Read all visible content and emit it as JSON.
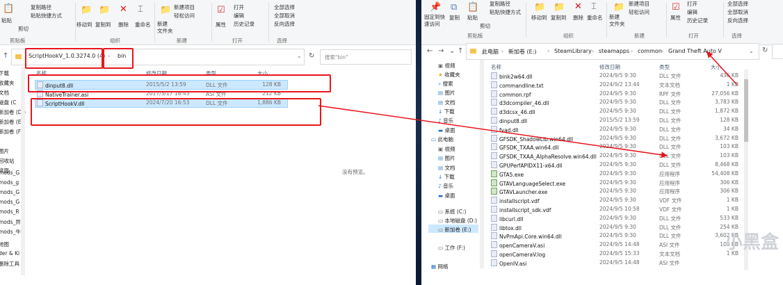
{
  "left": {
    "ribbon": {
      "paste": "粘贴",
      "copy_path": "复制路径",
      "paste_shortcut": "粘贴快捷方式",
      "cut": "剪切",
      "move_to": "移动到",
      "copy_to": "复制到",
      "delete": "删除",
      "rename": "重命名",
      "new_folder": "新建\n文件夹",
      "new_item": "新建项目",
      "easy_access": "轻松访问",
      "properties": "属性",
      "open": "打开",
      "edit": "编辑",
      "history": "历史记录",
      "select_all": "全部选择",
      "select_none": "全部取消",
      "invert": "反向选择",
      "groups": [
        "剪贴板",
        "组织",
        "新建",
        "打开",
        "选择"
      ]
    },
    "breadcrumb": [
      "ScriptHookV_1.0.3274.0 (4)",
      "bin"
    ],
    "search_placeholder": "搜索\"bin\"",
    "sidebar": [
      "下载",
      "收藏夹",
      "文档",
      "磁盘 (C",
      "新加卷 (D:)",
      "新加卷 (E:)",
      "新加卷 (F:)",
      "图片",
      "回收站",
      "桌面",
      "mods_G",
      "mods_g",
      "mods_G",
      "mods_G",
      "mods_R",
      "mods_异",
      "mods_牛",
      "地图",
      "der & Ki",
      "删除工具"
    ],
    "columns": {
      "name": "名称",
      "date": "修改日期",
      "type": "类型",
      "size": "大小"
    },
    "files": [
      {
        "name": "dinput8.dll",
        "date": "2015/5/2 13:59",
        "type": "DLL 文件",
        "size": "128 KB"
      },
      {
        "name": "NativeTrainer.asi",
        "date": "2017/3/17 18:43",
        "type": "ASI 文件",
        "size": "212 KB"
      },
      {
        "name": "ScriptHookV.dll",
        "date": "2024/7/20 16:53",
        "type": "DLL 文件",
        "size": "1,886 KB"
      }
    ],
    "preview_empty": "没有预览。"
  },
  "right": {
    "ribbon": {
      "pin": "固定到快\n速访问",
      "copy": "复制",
      "paste": "粘贴",
      "copy_path": "复制路径",
      "paste_shortcut": "粘贴快捷方式",
      "cut": "剪切",
      "move_to": "移动到",
      "copy_to": "复制到",
      "delete": "删除",
      "rename": "重命名",
      "new_folder": "新建\n文件夹",
      "new_item": "新建项目",
      "easy_access": "轻松访问",
      "properties": "属性",
      "open": "打开",
      "edit": "编辑",
      "history": "历史记录",
      "select_all": "全部选择",
      "select_none": "全部取消",
      "invert": "反向选择",
      "groups": [
        "剪贴板",
        "组织",
        "新建",
        "打开",
        "选择"
      ]
    },
    "breadcrumb": [
      "此电脑",
      "新加卷 (E:)",
      "SteamLibrary",
      "steamapps",
      "common",
      "Grand Theft Auto V"
    ],
    "sidebar": [
      "视频",
      "收藏夹",
      "搜索",
      "图片",
      "文档",
      "下载",
      "音乐",
      "桌面",
      "此电脑",
      "视频",
      "图片",
      "文档",
      "下载",
      "音乐",
      "桌面",
      "系统 (C:)",
      "本地磁盘 (D:)",
      "新加卷 (E:)",
      "工作 (F:)",
      "网络"
    ],
    "columns": {
      "name": "名称",
      "date": "修改日期",
      "type": "类型",
      "size": "大小"
    },
    "files": [
      {
        "name": "bink2w64.dll",
        "date": "2024/9/5 9:30",
        "type": "DLL 文件",
        "size": "436 KB"
      },
      {
        "name": "commandline.txt",
        "date": "2024/9/2 13:44",
        "type": "文本文档",
        "size": "1 KB"
      },
      {
        "name": "common.rpf",
        "date": "2024/9/5 9:30",
        "type": "RPF 文件",
        "size": "27,056 KB"
      },
      {
        "name": "d3dcompiler_46.dll",
        "date": "2024/9/5 9:30",
        "type": "DLL 文件",
        "size": "3,783 KB"
      },
      {
        "name": "d3dcsx_46.dll",
        "date": "2024/9/5 9:30",
        "type": "DLL 文件",
        "size": "1,872 KB"
      },
      {
        "name": "dinput8.dll",
        "date": "2015/5/2 13:59",
        "type": "DLL 文件",
        "size": "128 KB"
      },
      {
        "name": "fvad.dll",
        "date": "2024/9/5 9:30",
        "type": "DLL 文件",
        "size": "34 KB"
      },
      {
        "name": "GFSDK_ShadowLib.win64.dll",
        "date": "2024/9/5 9:30",
        "type": "DLL 文件",
        "size": "3,672 KB"
      },
      {
        "name": "GFSDK_TXAA.win64.dll",
        "date": "2024/9/5 9:30",
        "type": "DLL 文件",
        "size": "103 KB"
      },
      {
        "name": "GFSDK_TXAA_AlphaResolve.win64.dll",
        "date": "2024/9/5 9:30",
        "type": "DLL 文件",
        "size": "103 KB"
      },
      {
        "name": "GPUPerfAPIDX11-x64.dll",
        "date": "2024/9/5 9:30",
        "type": "DLL 文件",
        "size": "8,468 KB"
      },
      {
        "name": "GTA5.exe",
        "date": "2024/9/5 9:30",
        "type": "应用程序",
        "size": "54,408 KB"
      },
      {
        "name": "GTAVLanguageSelect.exe",
        "date": "2024/9/5 9:30",
        "type": "应用程序",
        "size": "306 KB"
      },
      {
        "name": "GTAVLauncher.exe",
        "date": "2024/9/5 9:30",
        "type": "应用程序",
        "size": "306 KB"
      },
      {
        "name": "installscript.vdf",
        "date": "2024/9/5 9:30",
        "type": "VDF 文件",
        "size": "1 KB"
      },
      {
        "name": "installscript_sdk.vdf",
        "date": "2024/9/5 10:58",
        "type": "VDF 文件",
        "size": "1 KB"
      },
      {
        "name": "libcurl.dll",
        "date": "2024/9/5 9:30",
        "type": "DLL 文件",
        "size": "533 KB"
      },
      {
        "name": "libtox.dll",
        "date": "2024/9/5 9:30",
        "type": "DLL 文件",
        "size": "254 KB"
      },
      {
        "name": "NvPmApi.Core.win64.dll",
        "date": "2024/9/5 9:30",
        "type": "DLL 文件",
        "size": "3,602 KB"
      },
      {
        "name": "openCameraV.asi",
        "date": "2024/9/5 14:48",
        "type": "ASI 文件",
        "size": "106 KB"
      },
      {
        "name": "openCameraV.log",
        "date": "2024/9/5 15:33",
        "type": "文本文档",
        "size": "1 KB"
      },
      {
        "name": "OpenIV.asi",
        "date": "2024/9/5 14:48",
        "type": "ASI 文件",
        "size": ""
      }
    ],
    "watermark": "小黑盒"
  },
  "colors": {
    "annotation_red": "#e8141c",
    "selection": "#cce8ff",
    "accent": "#0063b1"
  }
}
